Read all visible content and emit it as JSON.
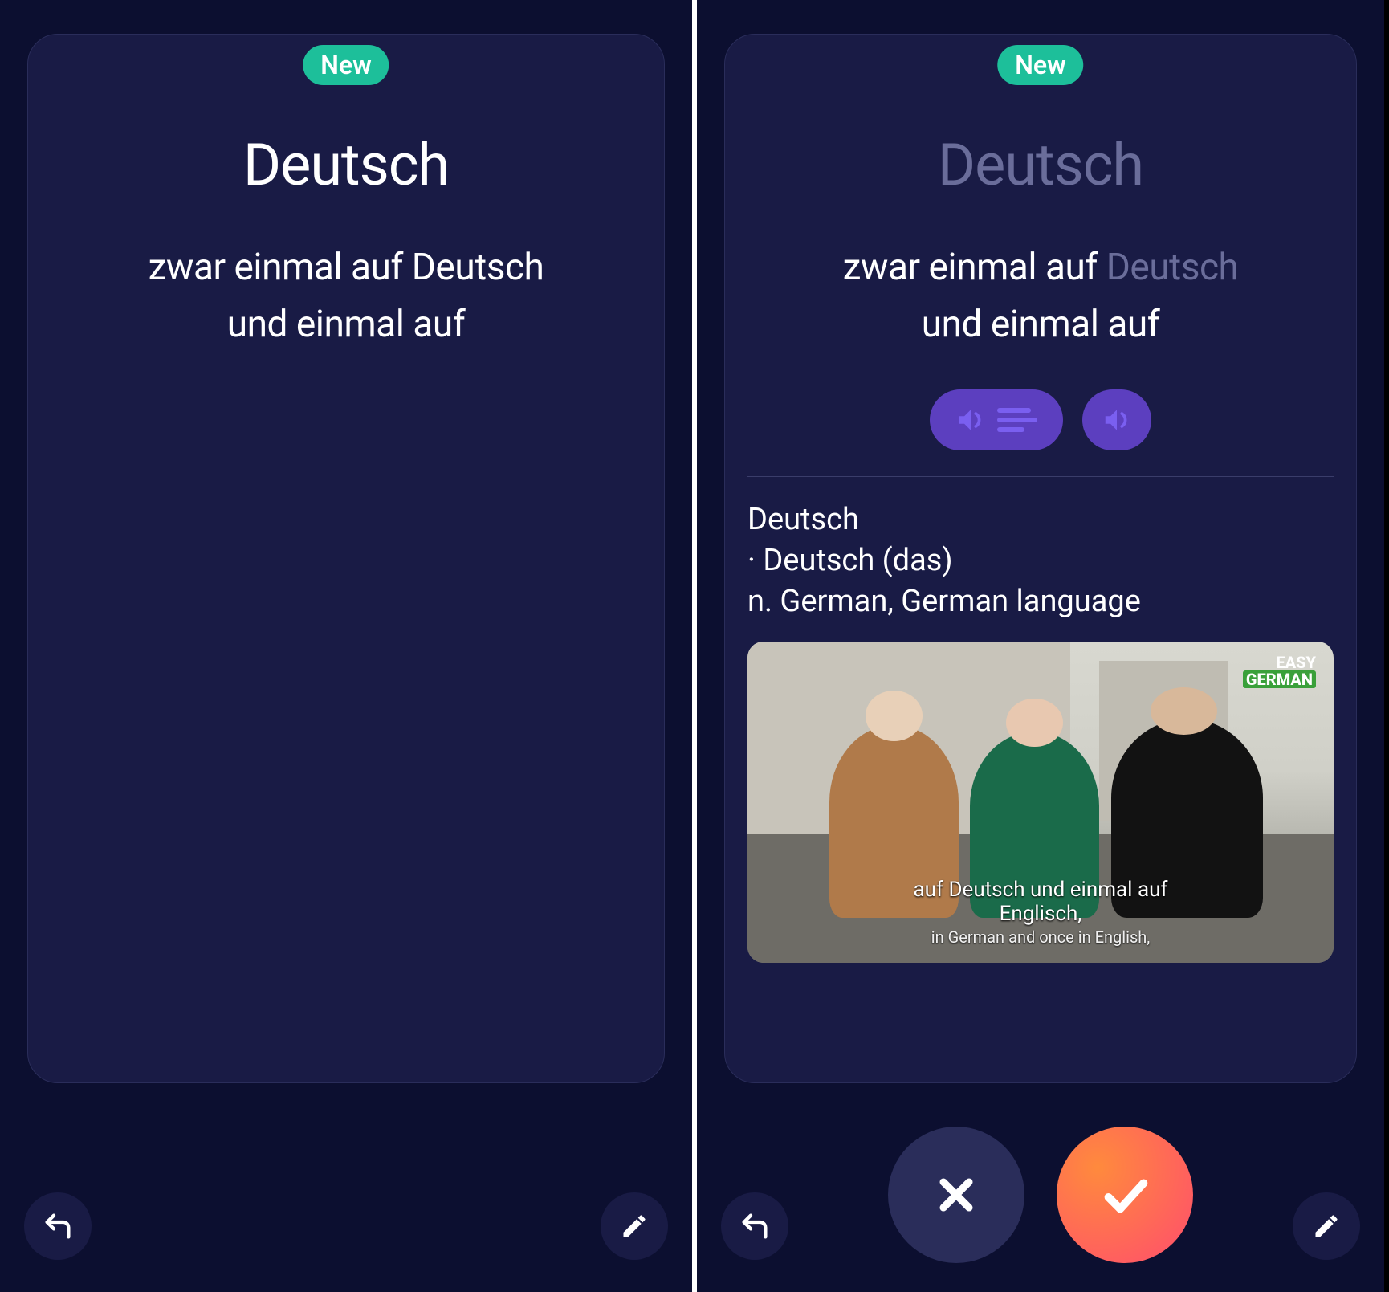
{
  "badge": "New",
  "left": {
    "headword": "Deutsch",
    "sentence_line1_pre": "zwar einmal auf ",
    "sentence_line1_hl": "Deutsch",
    "sentence_line2": "und einmal auf"
  },
  "right": {
    "headword": "Deutsch",
    "sentence_line1_pre": "zwar einmal auf ",
    "sentence_line1_hl": "Deutsch",
    "sentence_line2": "und einmal auf",
    "definition_line1": "Deutsch",
    "definition_line2": "· Deutsch (das)",
    "definition_line3": "n. German, German language",
    "video_tag_line1": "EASY",
    "video_tag_line2": "GERMAN",
    "subtitle_main": "auf Deutsch und einmal auf Englisch,",
    "subtitle_sub": "in German and once in English,"
  },
  "icons": {
    "undo": "undo-icon",
    "edit": "pencil-icon",
    "audio_sentence": "speaker-sentence-icon",
    "audio_word": "speaker-icon",
    "wrong": "close-icon",
    "correct": "check-icon"
  }
}
